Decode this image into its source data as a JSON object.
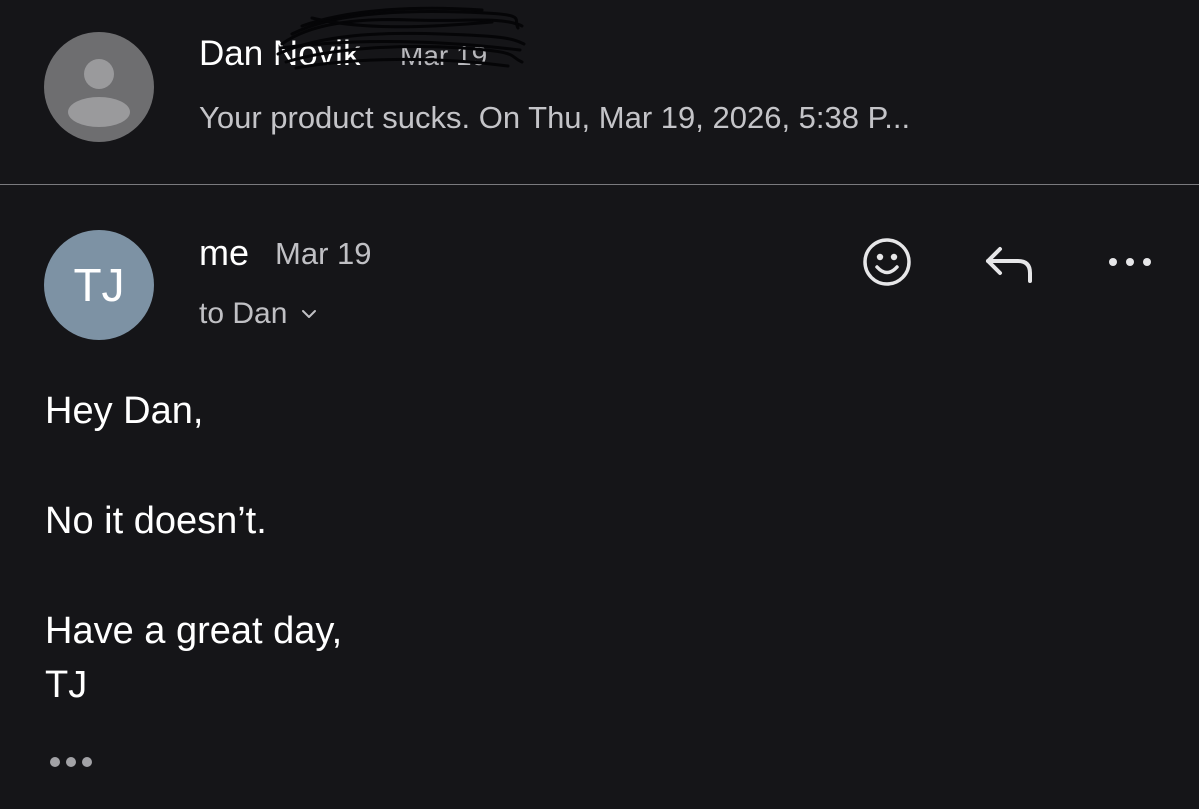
{
  "thread_collapsed": {
    "sender": "Dan Novik",
    "date": "Mar 19",
    "snippet": "Your product sucks. On Thu, Mar 19, 2026, 5:38 P...",
    "avatar_icon": "person-placeholder-icon"
  },
  "message": {
    "avatar_initials": "TJ",
    "avatar_color": "#7d92a4",
    "sender": "me",
    "date": "Mar 19",
    "recipients_label": "to Dan",
    "actions": {
      "emoji_icon": "emoji-reaction-icon",
      "reply_icon": "reply-icon",
      "more_icon": "more-options-icon"
    },
    "body": {
      "greeting": "Hey Dan,",
      "line1": "No it doesn’t.",
      "signoff": "Have a great day,",
      "signature": "TJ"
    },
    "trimmed_content_icon": "show-trimmed-content-icon"
  },
  "colors": {
    "background": "#151518",
    "divider": "#7a7a7e",
    "secondary_text": "#c0c0c4"
  }
}
